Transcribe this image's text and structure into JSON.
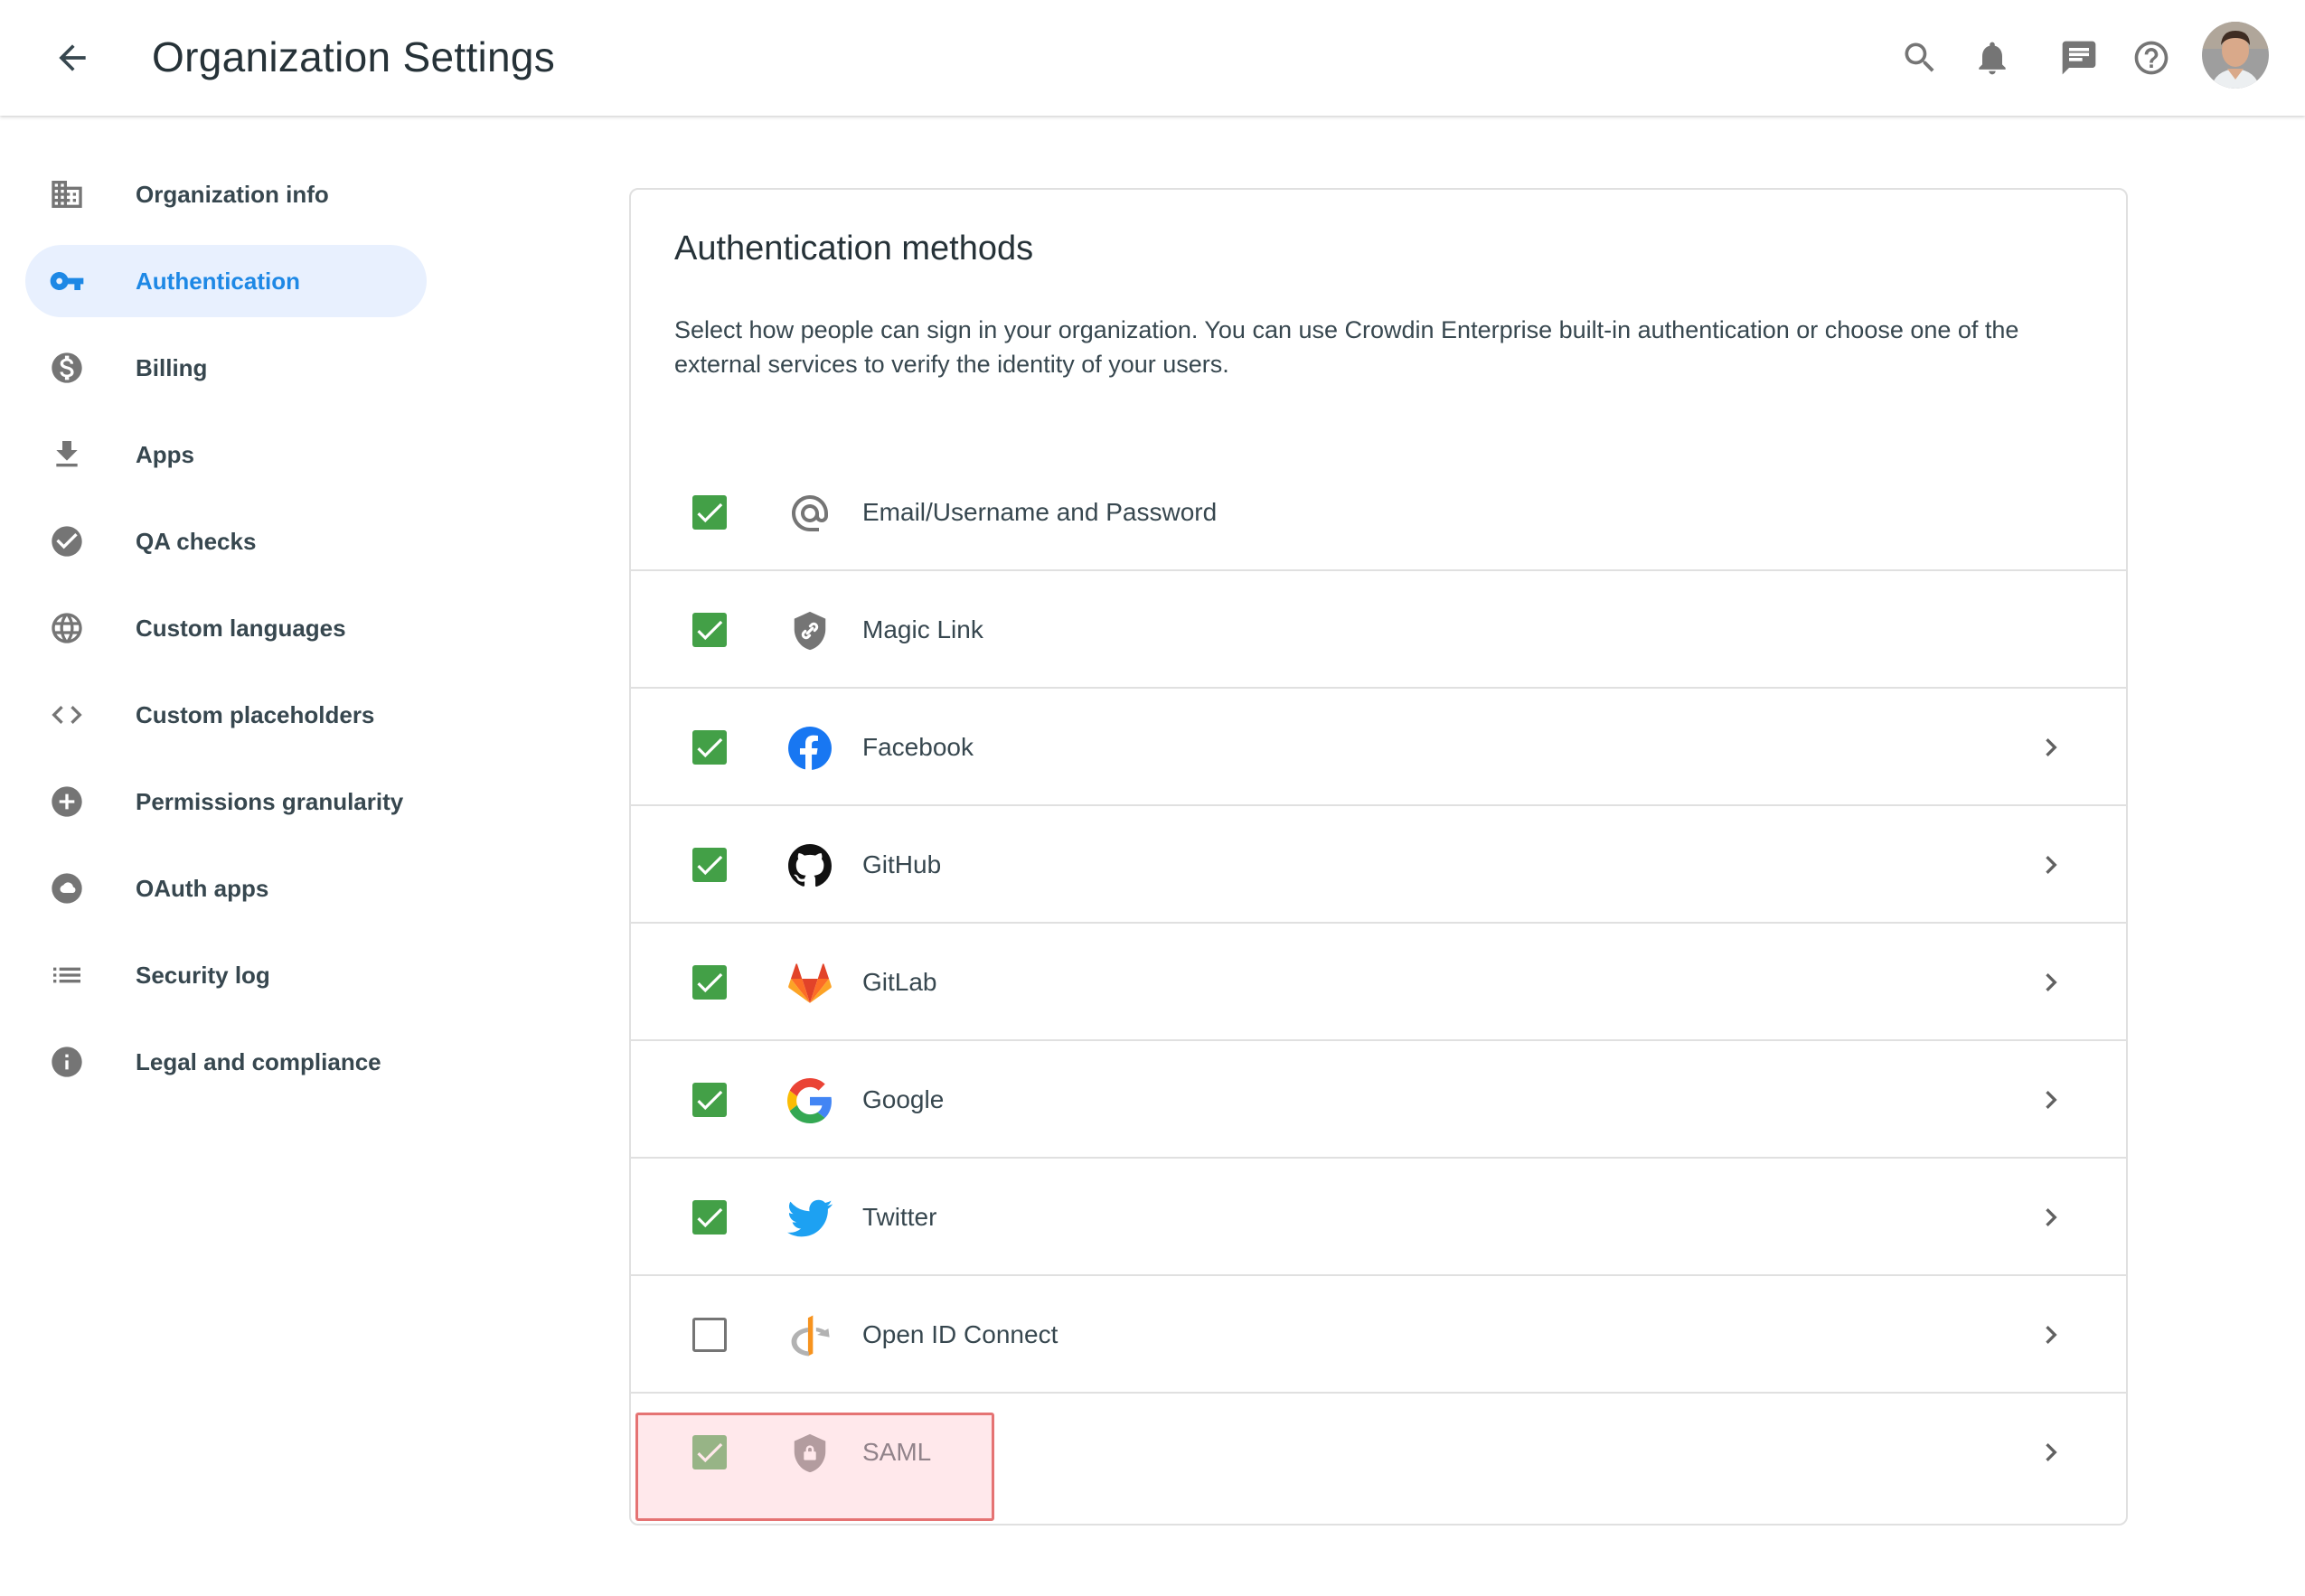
{
  "header": {
    "title": "Organization Settings",
    "icons": [
      "arrow-back-icon",
      "search-icon",
      "bell-icon",
      "chat-icon",
      "help-icon"
    ]
  },
  "sidebar": {
    "items": [
      {
        "label": "Organization info",
        "icon": "building-icon",
        "active": false
      },
      {
        "label": "Authentication",
        "icon": "key-icon",
        "active": true
      },
      {
        "label": "Billing",
        "icon": "dollar-icon",
        "active": false
      },
      {
        "label": "Apps",
        "icon": "download-icon",
        "active": false
      },
      {
        "label": "QA checks",
        "icon": "check-circle-icon",
        "active": false
      },
      {
        "label": "Custom languages",
        "icon": "globe-icon",
        "active": false
      },
      {
        "label": "Custom placeholders",
        "icon": "code-icon",
        "active": false
      },
      {
        "label": "Permissions granularity",
        "icon": "plus-circle-icon",
        "active": false
      },
      {
        "label": "OAuth apps",
        "icon": "cloud-icon",
        "active": false
      },
      {
        "label": "Security log",
        "icon": "list-icon",
        "active": false
      },
      {
        "label": "Legal and compliance",
        "icon": "info-icon",
        "active": false
      }
    ]
  },
  "card": {
    "title": "Authentication methods",
    "description": "Select how people can sign in your organization. You can use Crowdin Enterprise built-in authentication or choose one of the external services to verify the identity of your users."
  },
  "methods": [
    {
      "label": "Email/Username and Password",
      "icon": "at-sign-icon",
      "checked": true,
      "has_chevron": false
    },
    {
      "label": "Magic Link",
      "icon": "shield-link-icon",
      "checked": true,
      "has_chevron": false
    },
    {
      "label": "Facebook",
      "icon": "facebook-icon",
      "checked": true,
      "has_chevron": true
    },
    {
      "label": "GitHub",
      "icon": "github-icon",
      "checked": true,
      "has_chevron": true
    },
    {
      "label": "GitLab",
      "icon": "gitlab-icon",
      "checked": true,
      "has_chevron": true
    },
    {
      "label": "Google",
      "icon": "google-icon",
      "checked": true,
      "has_chevron": true
    },
    {
      "label": "Twitter",
      "icon": "twitter-icon",
      "checked": true,
      "has_chevron": true
    },
    {
      "label": "Open ID Connect",
      "icon": "openid-icon",
      "checked": false,
      "has_chevron": true
    },
    {
      "label": "SAML",
      "icon": "shield-lock-icon",
      "checked": true,
      "has_chevron": true
    }
  ],
  "colors": {
    "accent": "#1e88e5",
    "active_bg": "#e8f0fe",
    "checkbox_green": "#43a047",
    "highlight_border": "#e57373"
  }
}
